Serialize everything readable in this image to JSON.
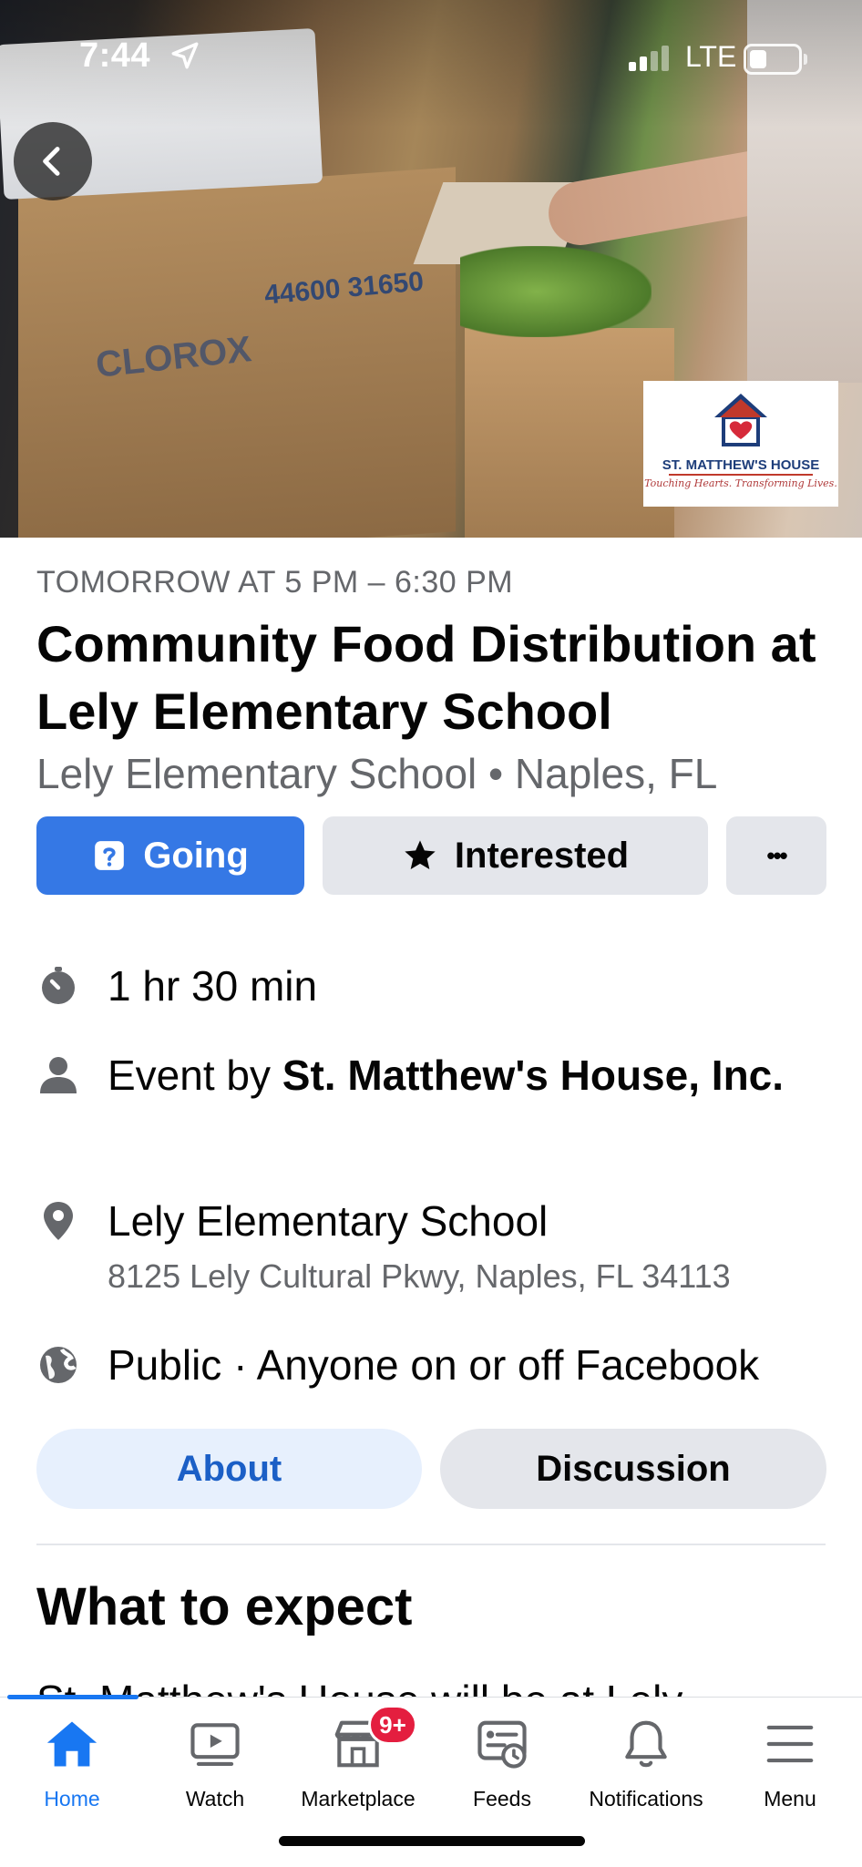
{
  "status_bar": {
    "time": "7:44",
    "network": "LTE"
  },
  "cover": {
    "logo_name": "ST. MATTHEW'S HOUSE",
    "logo_tagline": "Touching Hearts. Transforming Lives.",
    "box_text_1": "44600 31650",
    "box_text_2": "CLOROX"
  },
  "event": {
    "datetime": "TOMORROW AT 5 PM – 6:30 PM",
    "title": "Community Food Distribution at Lely Elementary School",
    "place": "Lely Elementary School • Naples, FL"
  },
  "actions": {
    "going": "Going",
    "interested": "Interested",
    "more": "•••"
  },
  "details": {
    "duration": "1 hr 30 min",
    "host_prefix": "Event by ",
    "host_name": "St. Matthew's House, Inc.",
    "location_name": "Lely Elementary School",
    "location_address": "8125 Lely Cultural Pkwy, Naples, FL 34113",
    "privacy": "Public · Anyone on or off Facebook"
  },
  "tabs": {
    "about": "About",
    "discussion": "Discussion"
  },
  "section": {
    "title": "What to expect",
    "description_partial": "St. Matthew's House will be at Lely"
  },
  "bottom_nav": {
    "items": [
      {
        "label": "Home",
        "icon": "home-icon"
      },
      {
        "label": "Watch",
        "icon": "watch-icon"
      },
      {
        "label": "Marketplace",
        "icon": "marketplace-icon"
      },
      {
        "label": "Feeds",
        "icon": "feeds-icon"
      },
      {
        "label": "Notifications",
        "icon": "bell-icon"
      },
      {
        "label": "Menu",
        "icon": "menu-icon"
      }
    ],
    "marketplace_badge": "9+"
  },
  "colors": {
    "accent": "#3578e5",
    "link_blue": "#1877f2",
    "muted": "#65676b",
    "badge_red": "#e41e3f"
  }
}
